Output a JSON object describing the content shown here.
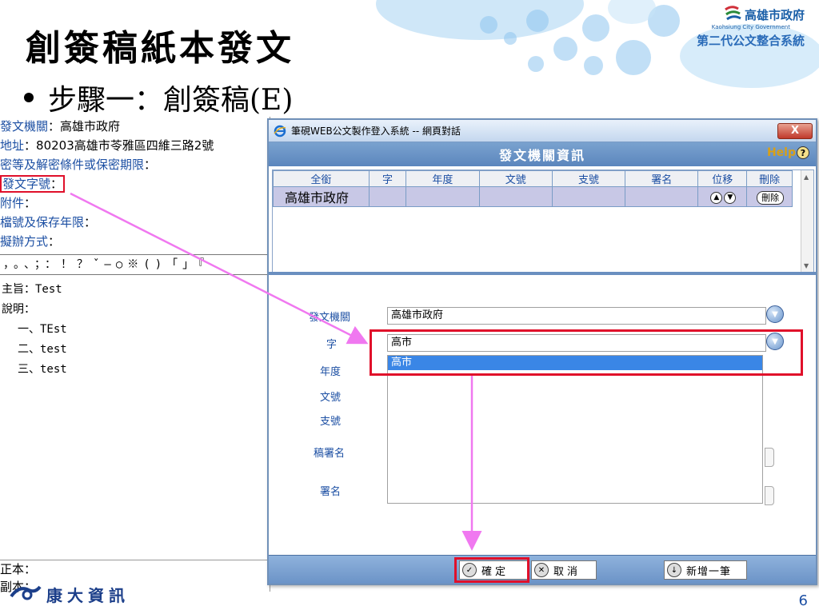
{
  "slide": {
    "title": "創簽稿紙本發文",
    "bullet": "步驟一：創簽稿(E)",
    "page_number": "6",
    "footer_logo_text": "康大資訊"
  },
  "logo": {
    "org": "高雄市政府",
    "org_en": "Kaohsiung City Government",
    "system": "第二代公文整合系統"
  },
  "document": {
    "fields": [
      {
        "label": "發文機關",
        "value": "高雄市政府"
      },
      {
        "label": "地址",
        "value": "80203高雄市苓雅區四維三路2號"
      },
      {
        "label": "密等及解密條件或保密期限",
        "value": ""
      },
      {
        "label": "發文字號",
        "value": ""
      },
      {
        "label": "附件",
        "value": ""
      },
      {
        "label": "檔號及保存年限",
        "value": ""
      },
      {
        "label": "擬辦方式",
        "value": ""
      }
    ],
    "punctuation": "，。、；：！？ˇ—○※()「」『",
    "subject": "主旨：Test",
    "explain_label": "說明：",
    "items": [
      "一、TEst",
      "二、test",
      "三、test"
    ],
    "bottom_labels": [
      "正本：",
      "副本："
    ]
  },
  "dialog": {
    "window_title": "筆硯WEB公文製作登入系統 -- 網頁對話",
    "close_label": "X",
    "header_title": "發文機關資訊",
    "help_label": "Help",
    "help_icon_glyph": "?",
    "table": {
      "columns": [
        "全銜",
        "字",
        "年度",
        "文號",
        "支號",
        "署名",
        "位移",
        "刪除"
      ],
      "rows": [
        {
          "name": "高雄市政府",
          "zi": "",
          "year": "",
          "num": "",
          "sub": "",
          "sign": "",
          "delete_label": "刪除"
        }
      ]
    },
    "form": {
      "labels": {
        "agency": "發文機關",
        "zi": "字",
        "year": "年度",
        "num": "文號",
        "sub": "支號",
        "draft_sign": "稿署名",
        "sign": "署名"
      },
      "agency_value": "高雄市政府",
      "zi_value": "高市",
      "zi_dropdown_selected": "高市"
    },
    "buttons": {
      "confirm": "確定",
      "cancel": "取消",
      "add": "新增一筆"
    }
  },
  "colors": {
    "highlight_red": "#e0102a",
    "arrow_pink": "#f078f0",
    "accent_blue": "#1c4fa3"
  }
}
